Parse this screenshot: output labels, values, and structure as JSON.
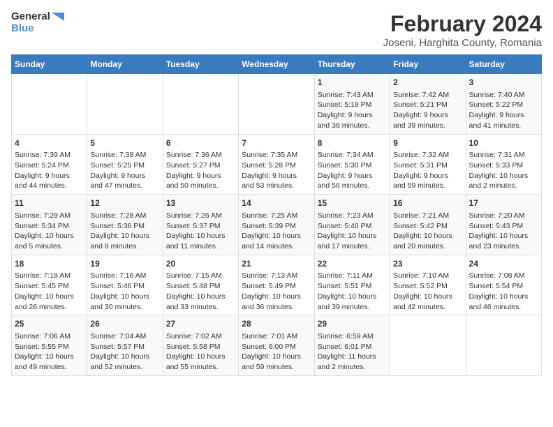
{
  "logo": {
    "general": "General",
    "blue": "Blue"
  },
  "title": "February 2024",
  "subtitle": "Joseni, Harghita County, Romania",
  "days_header": [
    "Sunday",
    "Monday",
    "Tuesday",
    "Wednesday",
    "Thursday",
    "Friday",
    "Saturday"
  ],
  "weeks": [
    [
      {
        "day": "",
        "content": ""
      },
      {
        "day": "",
        "content": ""
      },
      {
        "day": "",
        "content": ""
      },
      {
        "day": "",
        "content": ""
      },
      {
        "day": "1",
        "content": "Sunrise: 7:43 AM\nSunset: 5:19 PM\nDaylight: 9 hours\nand 36 minutes."
      },
      {
        "day": "2",
        "content": "Sunrise: 7:42 AM\nSunset: 5:21 PM\nDaylight: 9 hours\nand 39 minutes."
      },
      {
        "day": "3",
        "content": "Sunrise: 7:40 AM\nSunset: 5:22 PM\nDaylight: 9 hours\nand 41 minutes."
      }
    ],
    [
      {
        "day": "4",
        "content": "Sunrise: 7:39 AM\nSunset: 5:24 PM\nDaylight: 9 hours\nand 44 minutes."
      },
      {
        "day": "5",
        "content": "Sunrise: 7:38 AM\nSunset: 5:25 PM\nDaylight: 9 hours\nand 47 minutes."
      },
      {
        "day": "6",
        "content": "Sunrise: 7:36 AM\nSunset: 5:27 PM\nDaylight: 9 hours\nand 50 minutes."
      },
      {
        "day": "7",
        "content": "Sunrise: 7:35 AM\nSunset: 5:28 PM\nDaylight: 9 hours\nand 53 minutes."
      },
      {
        "day": "8",
        "content": "Sunrise: 7:34 AM\nSunset: 5:30 PM\nDaylight: 9 hours\nand 56 minutes."
      },
      {
        "day": "9",
        "content": "Sunrise: 7:32 AM\nSunset: 5:31 PM\nDaylight: 9 hours\nand 59 minutes."
      },
      {
        "day": "10",
        "content": "Sunrise: 7:31 AM\nSunset: 5:33 PM\nDaylight: 10 hours\nand 2 minutes."
      }
    ],
    [
      {
        "day": "11",
        "content": "Sunrise: 7:29 AM\nSunset: 5:34 PM\nDaylight: 10 hours\nand 5 minutes."
      },
      {
        "day": "12",
        "content": "Sunrise: 7:28 AM\nSunset: 5:36 PM\nDaylight: 10 hours\nand 8 minutes."
      },
      {
        "day": "13",
        "content": "Sunrise: 7:26 AM\nSunset: 5:37 PM\nDaylight: 10 hours\nand 11 minutes."
      },
      {
        "day": "14",
        "content": "Sunrise: 7:25 AM\nSunset: 5:39 PM\nDaylight: 10 hours\nand 14 minutes."
      },
      {
        "day": "15",
        "content": "Sunrise: 7:23 AM\nSunset: 5:40 PM\nDaylight: 10 hours\nand 17 minutes."
      },
      {
        "day": "16",
        "content": "Sunrise: 7:21 AM\nSunset: 5:42 PM\nDaylight: 10 hours\nand 20 minutes."
      },
      {
        "day": "17",
        "content": "Sunrise: 7:20 AM\nSunset: 5:43 PM\nDaylight: 10 hours\nand 23 minutes."
      }
    ],
    [
      {
        "day": "18",
        "content": "Sunrise: 7:18 AM\nSunset: 5:45 PM\nDaylight: 10 hours\nand 26 minutes."
      },
      {
        "day": "19",
        "content": "Sunrise: 7:16 AM\nSunset: 5:46 PM\nDaylight: 10 hours\nand 30 minutes."
      },
      {
        "day": "20",
        "content": "Sunrise: 7:15 AM\nSunset: 5:48 PM\nDaylight: 10 hours\nand 33 minutes."
      },
      {
        "day": "21",
        "content": "Sunrise: 7:13 AM\nSunset: 5:49 PM\nDaylight: 10 hours\nand 36 minutes."
      },
      {
        "day": "22",
        "content": "Sunrise: 7:11 AM\nSunset: 5:51 PM\nDaylight: 10 hours\nand 39 minutes."
      },
      {
        "day": "23",
        "content": "Sunrise: 7:10 AM\nSunset: 5:52 PM\nDaylight: 10 hours\nand 42 minutes."
      },
      {
        "day": "24",
        "content": "Sunrise: 7:08 AM\nSunset: 5:54 PM\nDaylight: 10 hours\nand 46 minutes."
      }
    ],
    [
      {
        "day": "25",
        "content": "Sunrise: 7:06 AM\nSunset: 5:55 PM\nDaylight: 10 hours\nand 49 minutes."
      },
      {
        "day": "26",
        "content": "Sunrise: 7:04 AM\nSunset: 5:57 PM\nDaylight: 10 hours\nand 52 minutes."
      },
      {
        "day": "27",
        "content": "Sunrise: 7:02 AM\nSunset: 5:58 PM\nDaylight: 10 hours\nand 55 minutes."
      },
      {
        "day": "28",
        "content": "Sunrise: 7:01 AM\nSunset: 6:00 PM\nDaylight: 10 hours\nand 59 minutes."
      },
      {
        "day": "29",
        "content": "Sunrise: 6:59 AM\nSunset: 6:01 PM\nDaylight: 11 hours\nand 2 minutes."
      },
      {
        "day": "",
        "content": ""
      },
      {
        "day": "",
        "content": ""
      }
    ]
  ]
}
